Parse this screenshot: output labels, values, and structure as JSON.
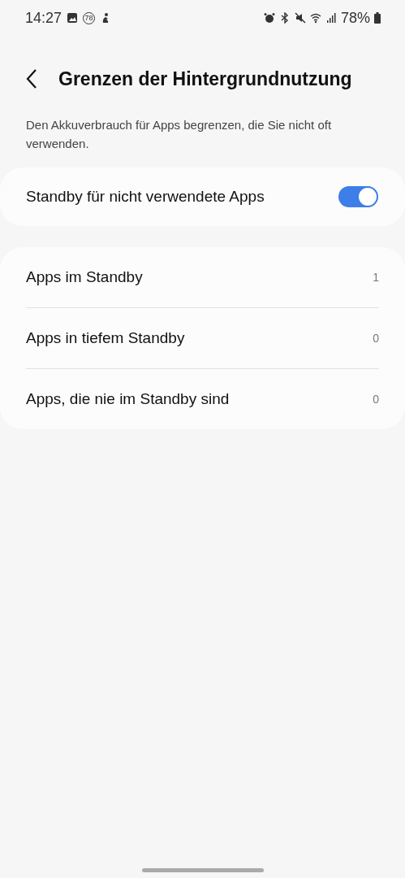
{
  "status_bar": {
    "time": "14:27",
    "notification_badge": "78",
    "battery": "78%"
  },
  "header": {
    "title": "Grenzen der Hintergrundnutzung"
  },
  "description": "Den Akkuverbrauch für Apps begrenzen, die Sie nicht oft verwenden.",
  "toggle": {
    "label": "Standby für nicht verwendete Apps",
    "on": true
  },
  "items": [
    {
      "label": "Apps im Standby",
      "count": "1"
    },
    {
      "label": "Apps in tiefem Standby",
      "count": "0"
    },
    {
      "label": "Apps, die nie im Standby sind",
      "count": "0"
    }
  ]
}
